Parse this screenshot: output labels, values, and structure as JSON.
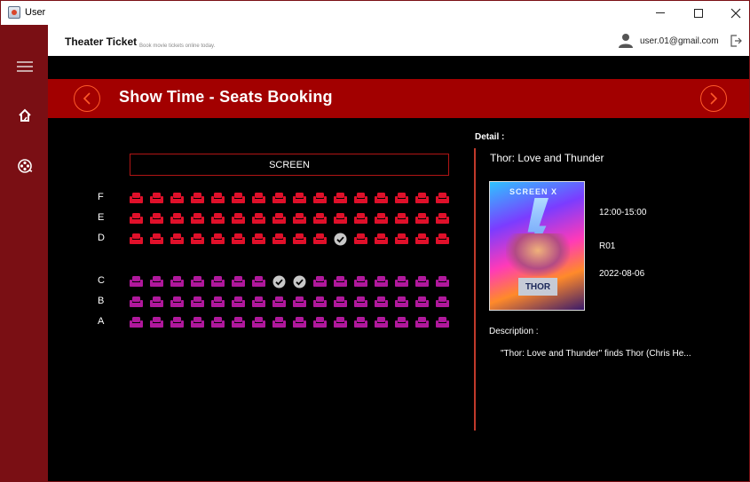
{
  "window": {
    "title": "User"
  },
  "header": {
    "brand": "Theater Ticket",
    "tagline": "Book movie tickets online today.",
    "user_email": "user.01@gmail.com"
  },
  "sidebar": {
    "items": [
      {
        "icon": "menu-icon"
      },
      {
        "icon": "home-icon"
      },
      {
        "icon": "film-reel-icon"
      }
    ]
  },
  "banner": {
    "title": "Show Time - Seats Booking"
  },
  "seating": {
    "screen_label": "SCREEN",
    "seats_per_row": 16,
    "rows": [
      {
        "label": "F",
        "zone": "red",
        "selected": []
      },
      {
        "label": "E",
        "zone": "red",
        "selected": []
      },
      {
        "label": "D",
        "zone": "red",
        "selected": [
          10
        ]
      },
      {
        "label": "C",
        "zone": "purple",
        "selected": [
          7,
          8
        ]
      },
      {
        "label": "B",
        "zone": "purple",
        "selected": []
      },
      {
        "label": "A",
        "zone": "purple",
        "selected": []
      }
    ],
    "colors": {
      "red": "#e0102a",
      "purple": "#b0189c",
      "selected": "#c8c8c8"
    }
  },
  "detail": {
    "label": "Detail :",
    "movie_title": "Thor: Love and Thunder",
    "poster_caption": "SCREEN X",
    "poster_logo": "THOR",
    "time": "12:00-15:00",
    "room": "R01",
    "date": "2022-08-06",
    "description_label": "Description :",
    "description": "\"Thor: Love and Thunder\" finds Thor (Chris He..."
  },
  "colors": {
    "accent": "#a20000",
    "sidebar": "#7a0f14",
    "nav_ring": "#ff5a2a"
  }
}
